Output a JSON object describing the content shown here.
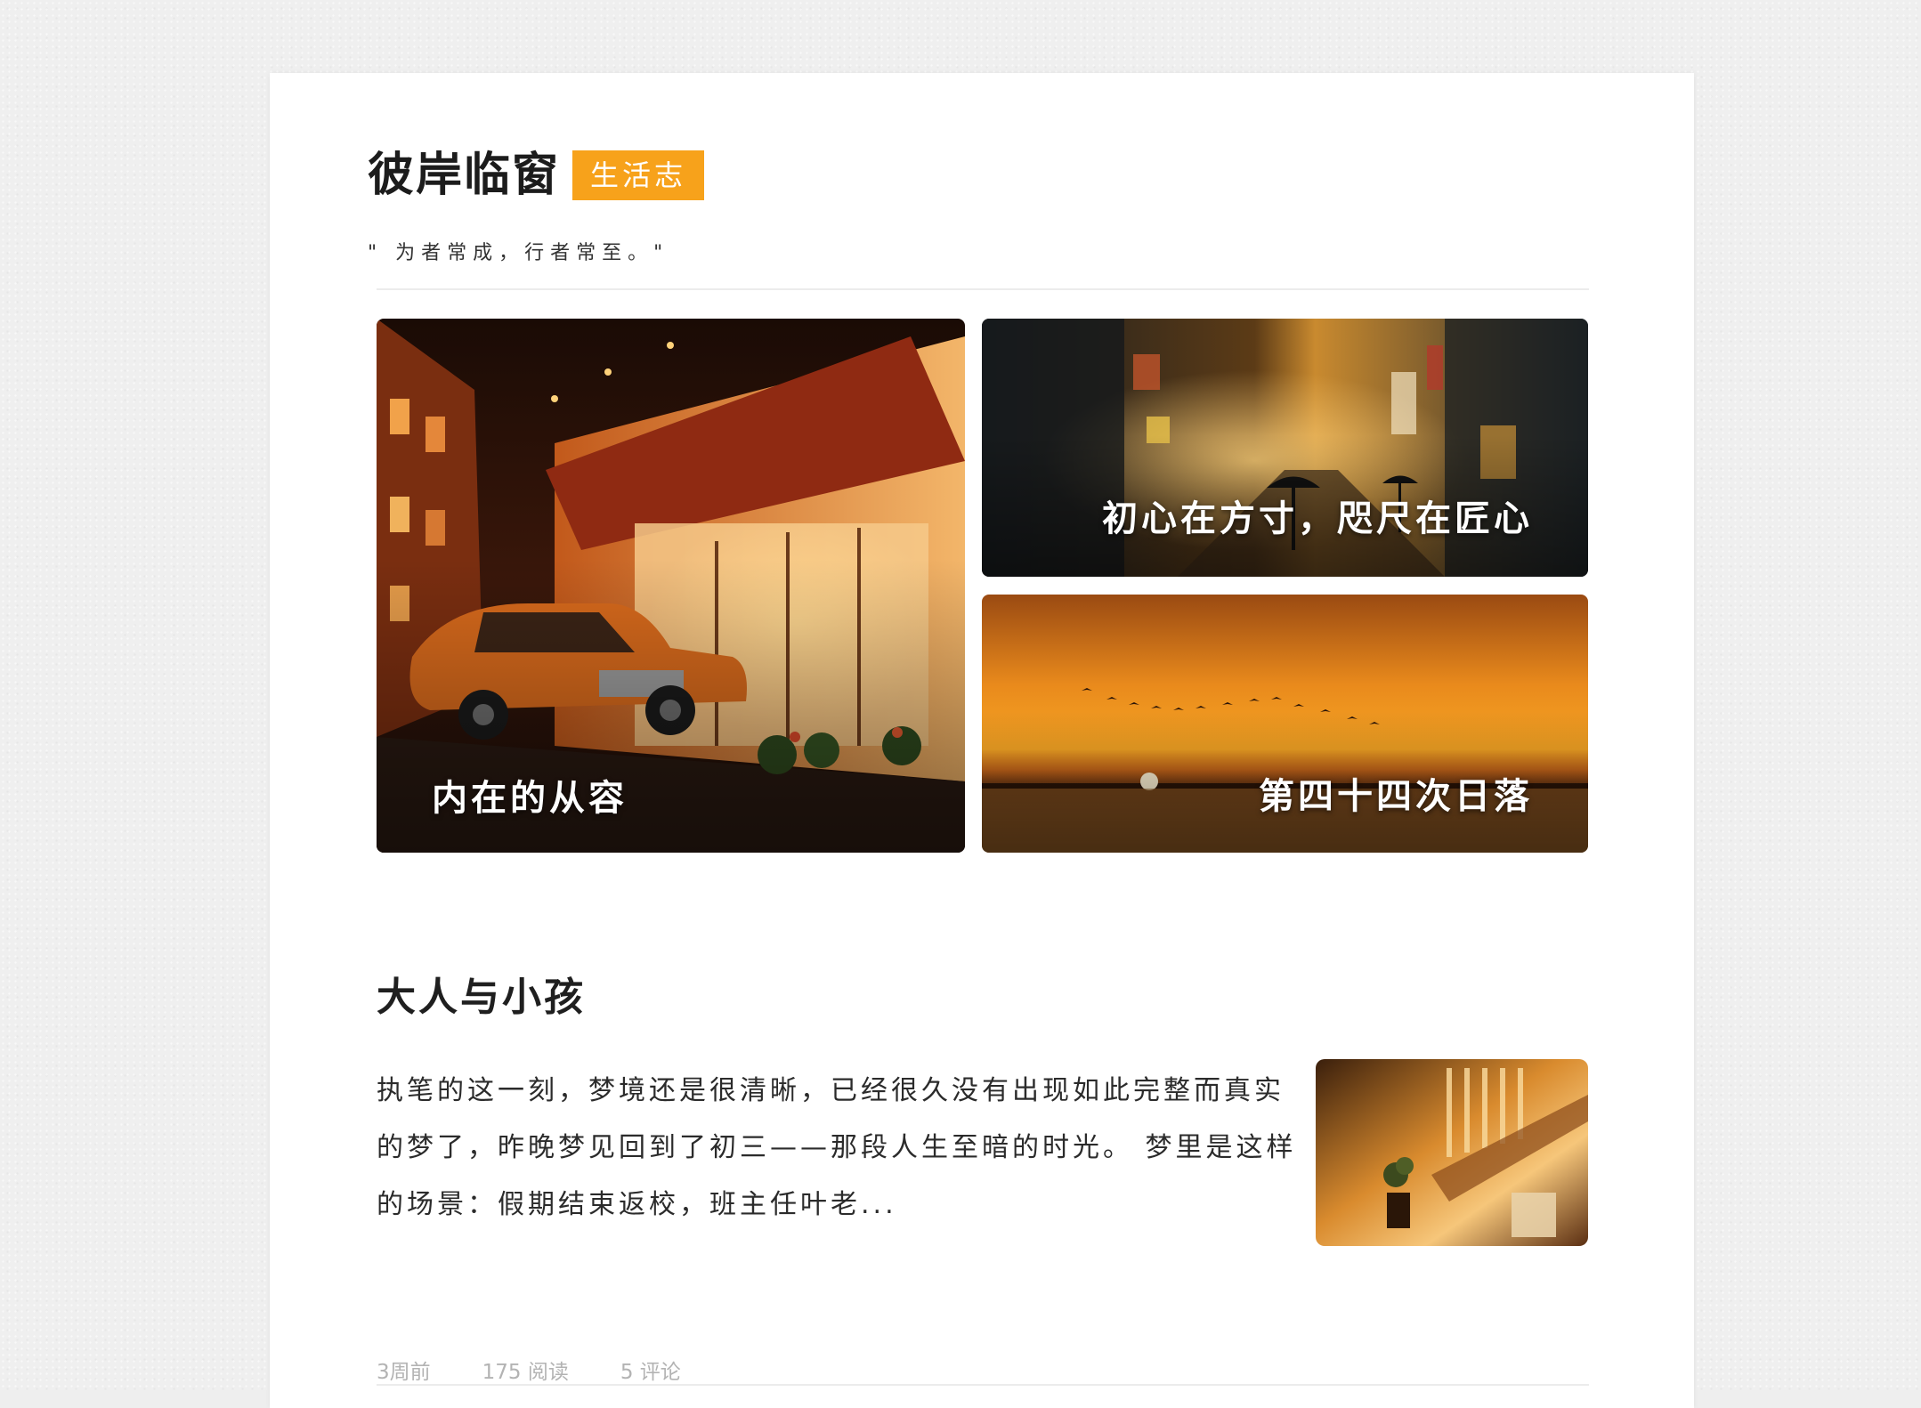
{
  "site": {
    "title": "彼岸临窗",
    "tag": "生活志",
    "motto": "\" 为者常成，行者常至。\""
  },
  "featured": [
    {
      "caption": "内在的从容",
      "image": "night-cafe-orange-car"
    },
    {
      "caption": "初心在方寸，咫尺在匠心",
      "image": "rainy-city-street-umbrellas"
    },
    {
      "caption": "第四十四次日落",
      "image": "sunset-field-birds"
    }
  ],
  "post": {
    "title": "大人与小孩",
    "excerpt": "执笔的这一刻，梦境还是很清晰，已经很久没有出现如此完整而真实的梦了，昨晚梦见回到了初三——那段人生至暗的时光。 梦里是这样的场景：假期结束返校，班主任叶老...",
    "thumbnail": "sunlit-staircase-interior",
    "meta": {
      "time": "3周前",
      "reads": "175 阅读",
      "comments": "5 评论"
    }
  },
  "colors": {
    "accent": "#f7a21b",
    "background": "#efefef",
    "card": "#ffffff"
  }
}
